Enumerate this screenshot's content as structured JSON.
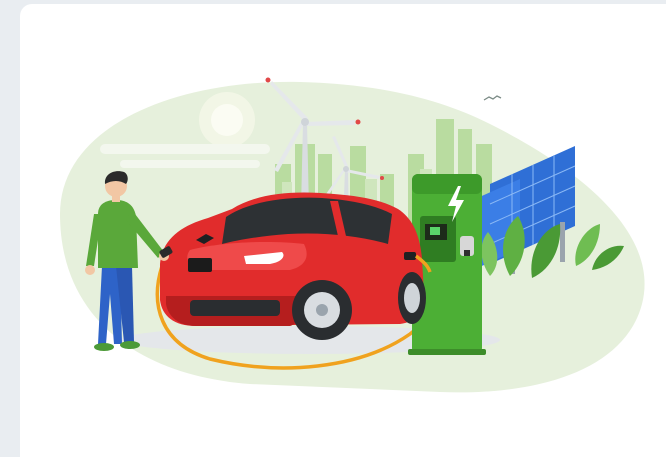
{
  "illustration": {
    "colors": {
      "page_background": "#e9edf1",
      "card_background": "#ffffff",
      "backdrop_green": "#e6f0dc",
      "city_green": "#a8d08d",
      "car_red": "#e12c2c",
      "charger_green": "#4caf35",
      "cable_orange": "#f0a21e",
      "solar_blue": "#2f6fd6",
      "shirt_green": "#5aa83a",
      "pants_blue": "#2e63c8"
    },
    "icons": [
      "sun-icon",
      "bird-icon",
      "lightning-bolt-icon"
    ],
    "plate_text": ""
  }
}
